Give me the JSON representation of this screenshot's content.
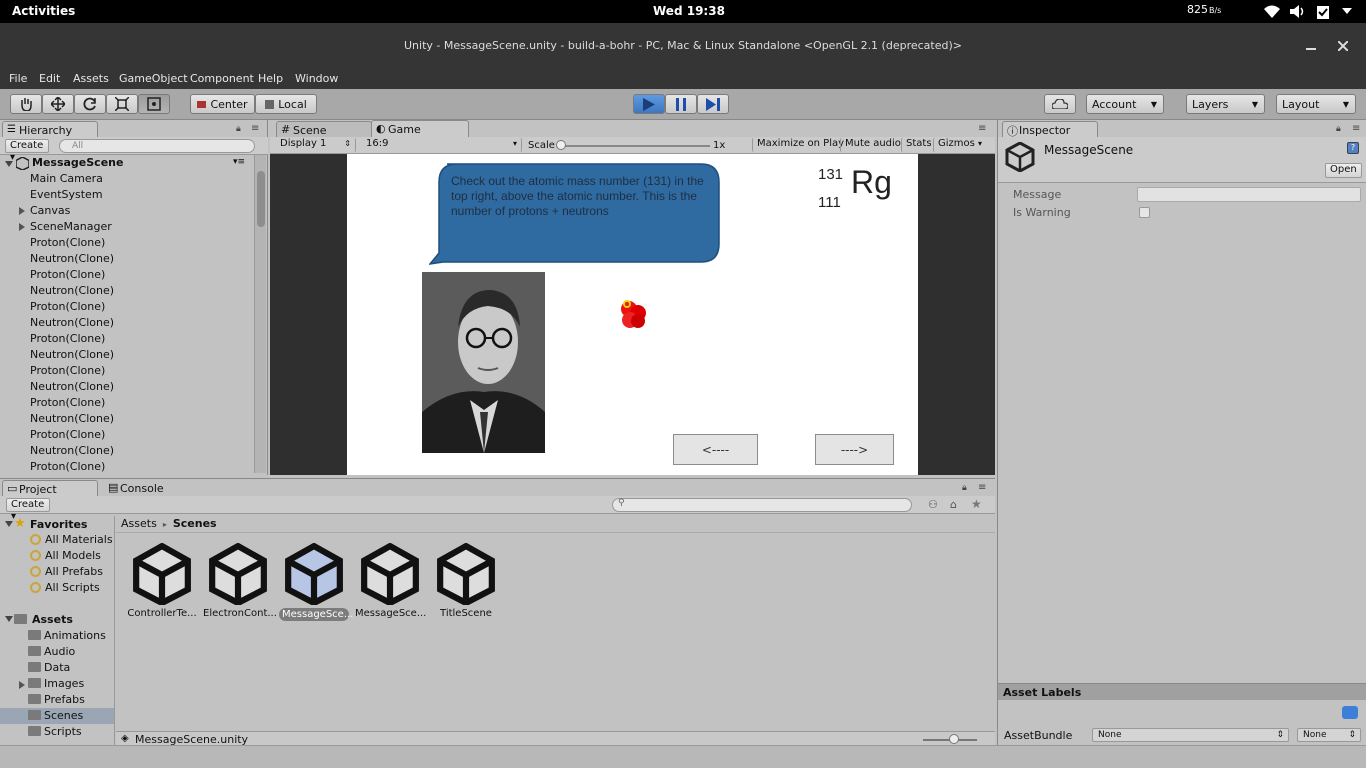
{
  "topbar": {
    "activities": "Activities",
    "clock": "Wed 19:38",
    "netspeed": "825",
    "netunit": "B/s"
  },
  "window": {
    "title": "Unity - MessageScene.unity - build-a-bohr - PC, Mac & Linux Standalone <OpenGL 2.1 (deprecated)>"
  },
  "menu": [
    "File",
    "Edit",
    "Assets",
    "GameObject",
    "Component",
    "Help",
    "Window"
  ],
  "toolbar": {
    "center": "Center",
    "local": "Local",
    "account": "Account",
    "layers": "Layers",
    "layout": "Layout"
  },
  "hierarchy": {
    "tab": "Hierarchy",
    "create": "Create",
    "search_placeholder": "All",
    "scene": "MessageScene",
    "items": [
      "Main Camera",
      "EventSystem",
      "Canvas",
      "SceneManager",
      "Proton(Clone)",
      "Neutron(Clone)",
      "Proton(Clone)",
      "Neutron(Clone)",
      "Proton(Clone)",
      "Neutron(Clone)",
      "Proton(Clone)",
      "Neutron(Clone)",
      "Proton(Clone)",
      "Neutron(Clone)",
      "Proton(Clone)",
      "Neutron(Clone)",
      "Proton(Clone)",
      "Neutron(Clone)",
      "Proton(Clone)"
    ]
  },
  "gameview": {
    "tab_scene": "Scene",
    "tab_game": "Game",
    "display": "Display 1",
    "aspect": "16:9",
    "scale_label": "Scale",
    "scale_value": "1x",
    "maximize": "Maximize on Play",
    "mute": "Mute audio",
    "stats": "Stats",
    "gizmos": "Gizmos",
    "bubble_text": "Check out the atomic mass number (131) in the top right, above the atomic number. This is the number of protons + neutrons",
    "mass_number": "131",
    "atomic_number": "111",
    "element_symbol": "Rg",
    "back_button": "<----",
    "next_button": "---->"
  },
  "inspector": {
    "tab": "Inspector",
    "object": "MessageScene",
    "open": "Open",
    "message_label": "Message",
    "message_value": "",
    "warning_label": "Is Warning",
    "asset_labels": "Asset Labels",
    "assetbundle": "AssetBundle",
    "none1": "None",
    "none2": "None"
  },
  "project": {
    "tab_project": "Project",
    "tab_console": "Console",
    "create": "Create",
    "favorites": "Favorites",
    "fav_items": [
      "All Materials",
      "All Models",
      "All Prefabs",
      "All Scripts"
    ],
    "assets": "Assets",
    "folders": [
      "Animations",
      "Audio",
      "Data",
      "Images",
      "Prefabs",
      "Scenes",
      "Scripts"
    ],
    "breadcrumb_root": "Assets",
    "breadcrumb_leaf": "Scenes",
    "files": [
      "ControllerTe...",
      "ElectronCont...",
      "MessageSce...",
      "MessageSce...",
      "TitleScene"
    ],
    "footer_file": "MessageScene.unity"
  }
}
